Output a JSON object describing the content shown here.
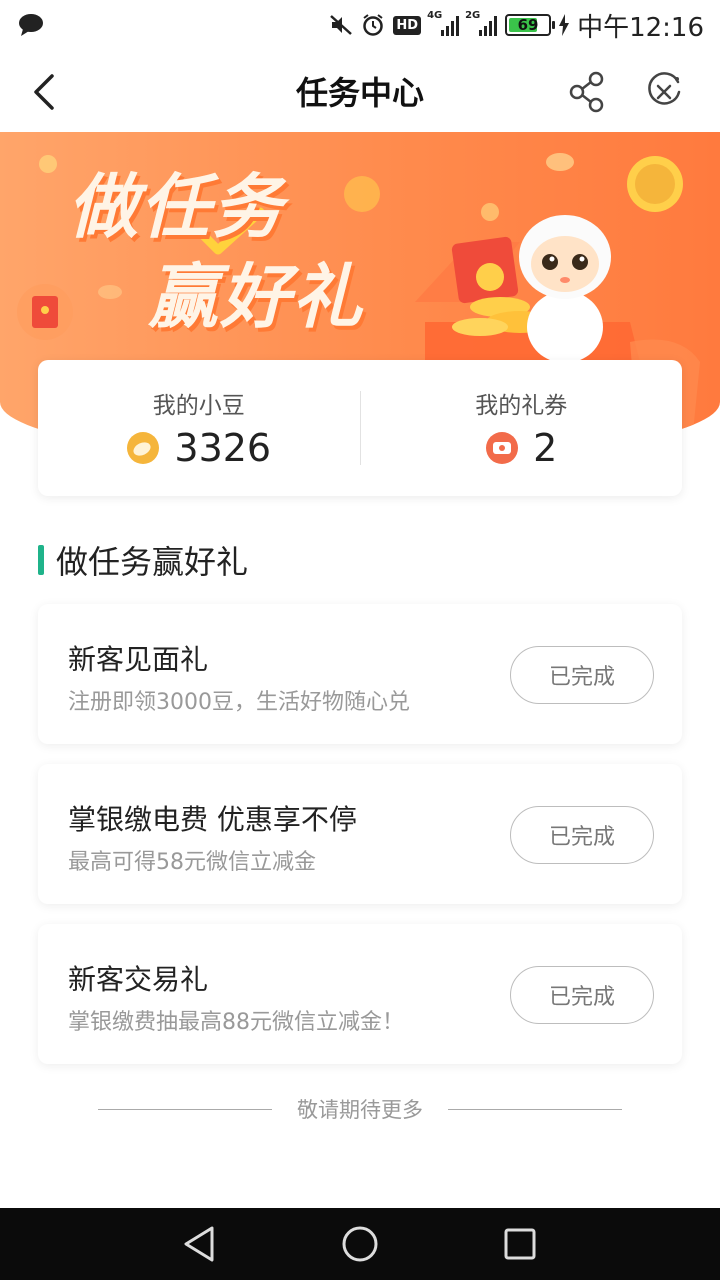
{
  "status_bar": {
    "time": "中午12:16",
    "battery": "69",
    "net1": "4G",
    "net2": "2G",
    "hd": "HD",
    "icons": [
      "chat-bubble-icon",
      "mute-icon",
      "alarm-icon",
      "hd-icon",
      "signal-icon",
      "battery-icon",
      "charging-icon"
    ]
  },
  "nav": {
    "title": "任务中心",
    "icons": [
      "back-arrow-icon",
      "share-icon",
      "close-circle-icon"
    ]
  },
  "banner": {
    "line1": "做任务",
    "line2": "赢好礼"
  },
  "stats": {
    "beans_label": "我的小豆",
    "beans_value": "3326",
    "coupons_label": "我的礼券",
    "coupons_value": "2"
  },
  "section": {
    "title": "做任务赢好礼"
  },
  "tasks": [
    {
      "title": "新客见面礼",
      "desc": "注册即领3000豆，生活好物随心兑",
      "button": "已完成"
    },
    {
      "title": "掌银缴电费 优惠享不停",
      "desc": "最高可得58元微信立减金",
      "button": "已完成"
    },
    {
      "title": "新客交易礼",
      "desc": "掌银缴费抽最高88元微信立减金！",
      "button": "已完成"
    }
  ],
  "footer": {
    "hint": "敬请期待更多"
  },
  "colors": {
    "accent": "#1fb38a",
    "banner": "#ff8b4d",
    "coin": "#f5b53b",
    "coupon": "#f26b4a"
  }
}
